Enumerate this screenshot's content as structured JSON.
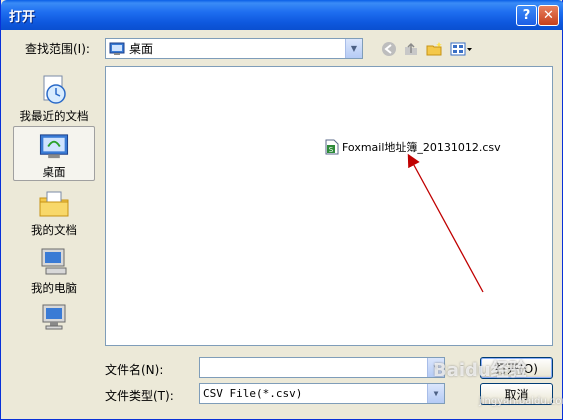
{
  "window": {
    "title": "打开"
  },
  "titlebar": {
    "help_label": "?",
    "close_label": "✕"
  },
  "lookin": {
    "label": "查找范围(I):",
    "value": "桌面",
    "icon": "desktop-icon"
  },
  "places": [
    {
      "label": "我最近的文档",
      "icon": "recent-documents-icon"
    },
    {
      "label": "桌面",
      "icon": "desktop-icon",
      "selected": true
    },
    {
      "label": "我的文档",
      "icon": "my-documents-icon"
    },
    {
      "label": "我的电脑",
      "icon": "my-computer-icon"
    },
    {
      "label": "",
      "icon": "network-places-icon"
    }
  ],
  "files": [
    {
      "name": "Foxmail地址簿_20131012.csv",
      "icon": "csv-file-icon"
    }
  ],
  "filename": {
    "label": "文件名(N):",
    "value": ""
  },
  "filetype": {
    "label": "文件类型(T):",
    "value": "CSV File(*.csv)"
  },
  "buttons": {
    "open_label": "打开(O)",
    "cancel_label": "取消"
  },
  "watermark": {
    "main": "Baidu经验",
    "sub": "jingyan.baidu.com"
  },
  "colors": {
    "titlebar": "#0a5ee6",
    "face": "#ece9d8",
    "border": "#7f9db9",
    "arrow": "#c00000"
  }
}
